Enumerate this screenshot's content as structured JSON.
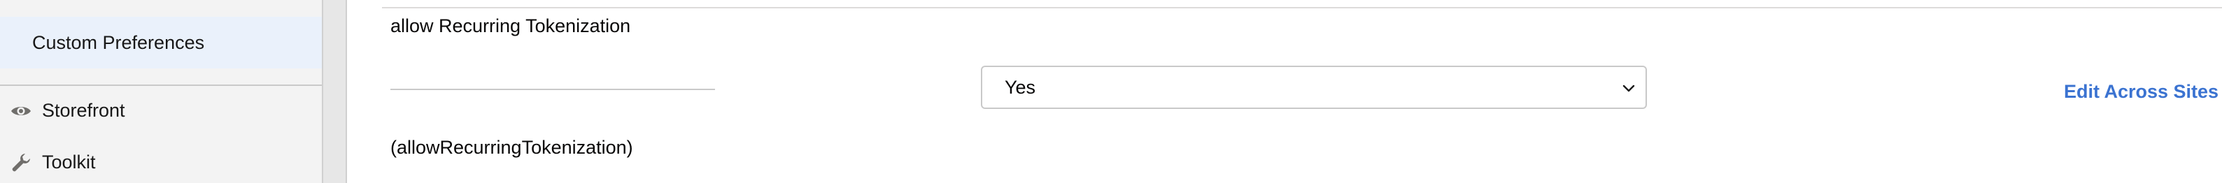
{
  "sidebar": {
    "active_item": "Custom Preferences",
    "items": [
      {
        "label": "Storefront",
        "icon": "eye-icon"
      },
      {
        "label": "Toolkit",
        "icon": "wrench-icon"
      }
    ]
  },
  "preference": {
    "label": "allow Recurring Tokenization",
    "id_text": "(allowRecurringTokenization)",
    "selected_value": "Yes",
    "edit_link": "Edit Across Sites"
  },
  "colors": {
    "link": "#3b73d1",
    "active_bg": "#eaf1fb",
    "sidebar_bg": "#f3f3f3"
  }
}
